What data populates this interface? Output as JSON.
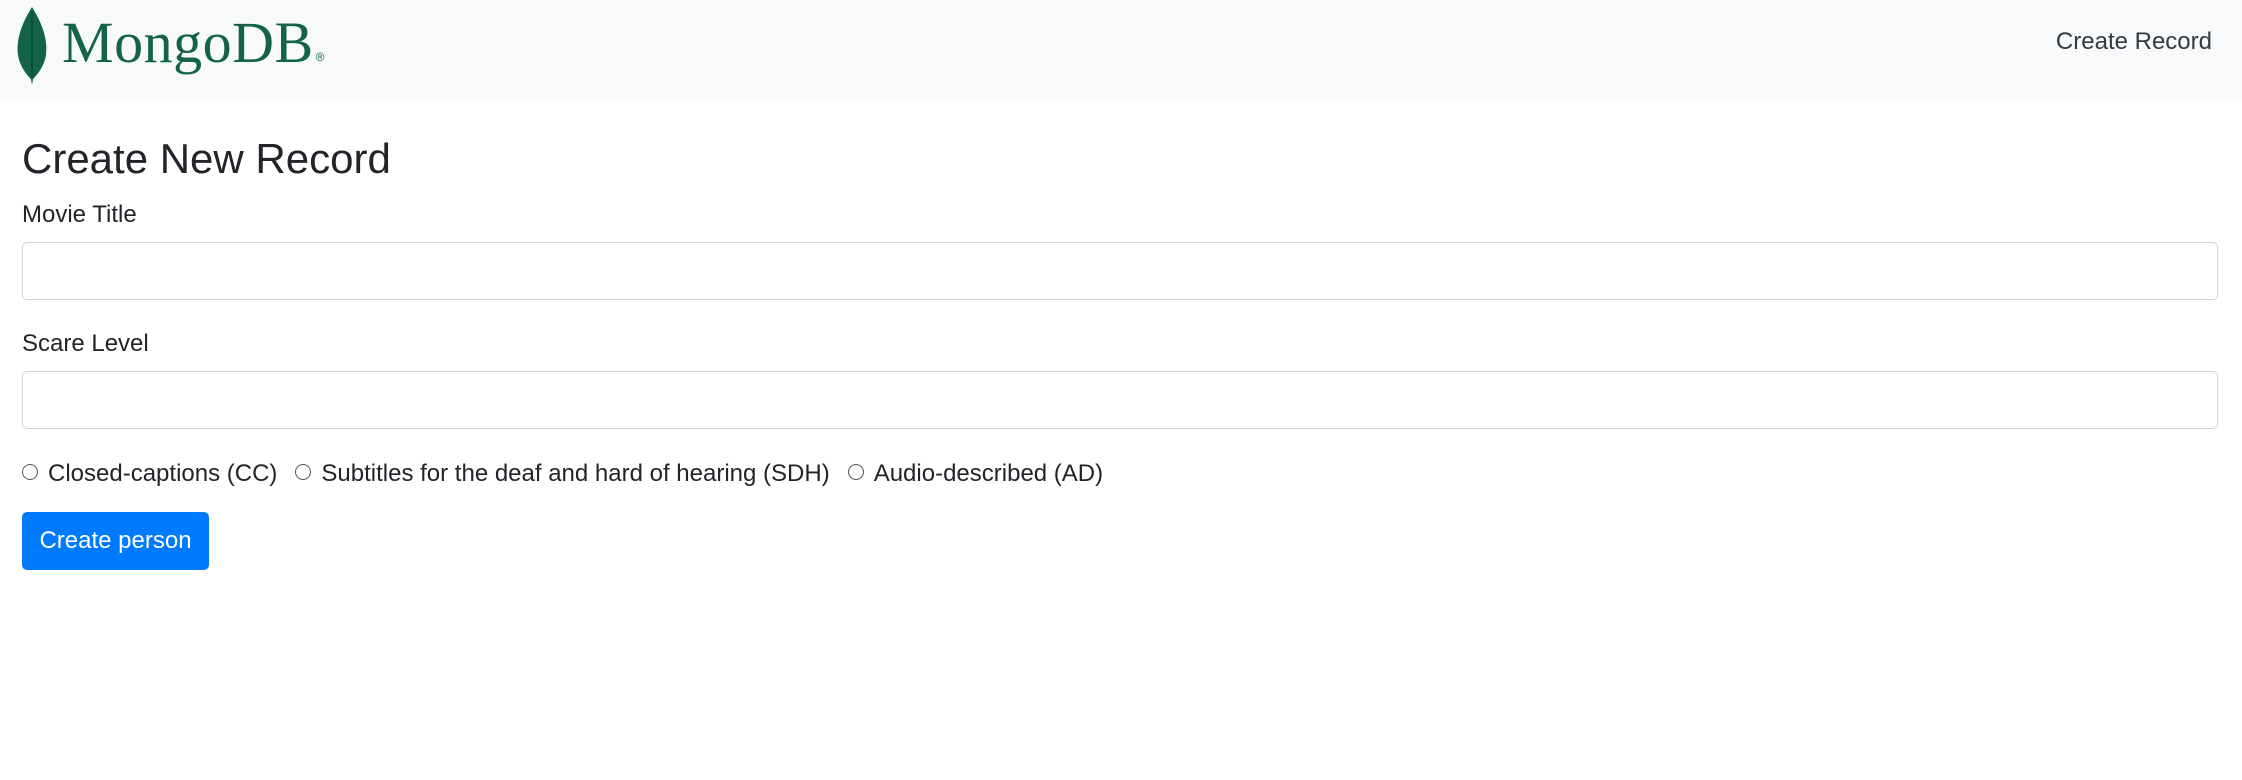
{
  "navbar": {
    "brand_text": "MongoDB",
    "brand_registered": "®",
    "brand_color": "#13624a",
    "create_record_link": "Create Record"
  },
  "form": {
    "title": "Create New Record",
    "movie_title_label": "Movie Title",
    "movie_title_value": "",
    "scare_level_label": "Scare Level",
    "scare_level_value": "",
    "options": [
      {
        "label": "Closed-captions (CC)",
        "checked": false
      },
      {
        "label": "Subtitles for the deaf and hard of hearing (SDH)",
        "checked": false
      },
      {
        "label": "Audio-described (AD)",
        "checked": false
      }
    ],
    "submit_label": "Create person",
    "submit_color": "#007bff"
  }
}
